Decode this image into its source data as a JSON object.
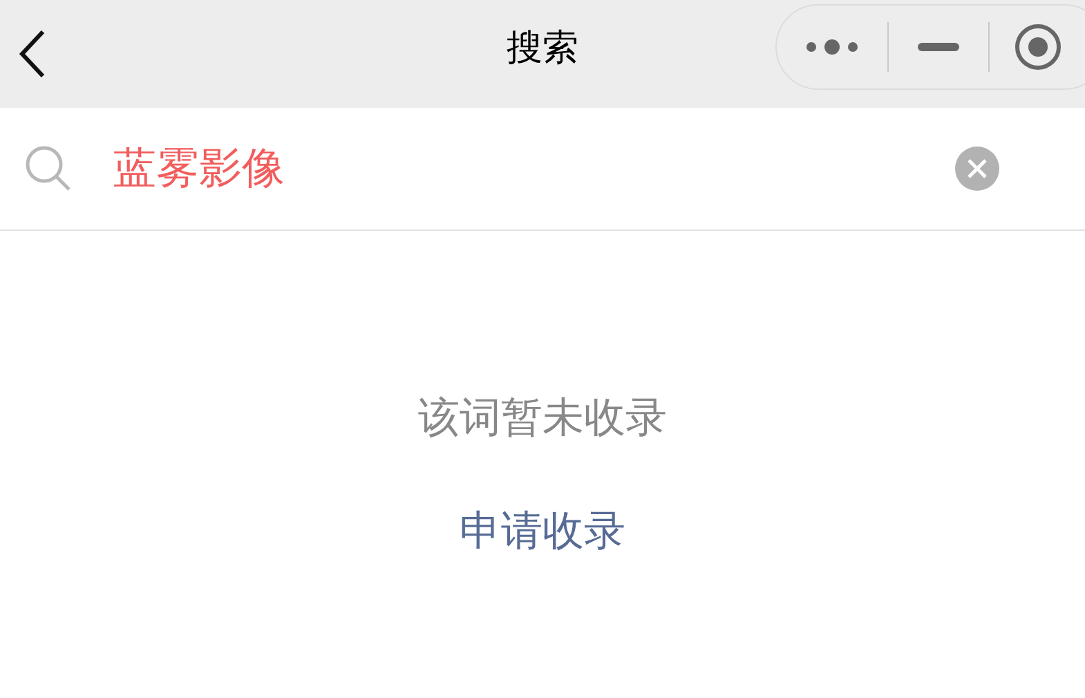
{
  "nav_bar": {
    "title": "搜索"
  },
  "search": {
    "value": "蓝雾影像"
  },
  "empty_state": {
    "message": "该词暂未收录",
    "link": "申请收录"
  }
}
